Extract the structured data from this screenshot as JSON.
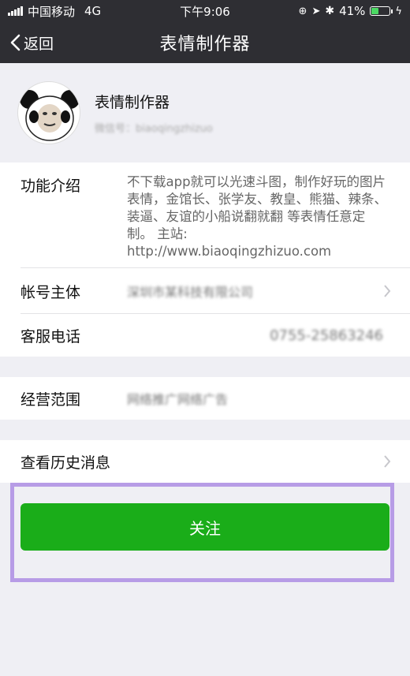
{
  "status_bar": {
    "carrier": "中国移动",
    "network": "4G",
    "time": "下午9:06",
    "battery_percent_label": "41%",
    "battery_level": 0.41
  },
  "nav": {
    "back_label": "返回",
    "title": "表情制作器"
  },
  "profile": {
    "name": "表情制作器",
    "wechat_id_blurred": "微信号：biaoqingzhizuo"
  },
  "info": {
    "intro_label": "功能介绍",
    "intro_text": "不下载app就可以光速斗图，制作好玩的图片表情，金馆长、张学友、教皇、熊猫、辣条、装逼、友谊的小船说翻就翻 等表情任意定制。 主站: http://www.biaoqingzhizuo.com",
    "account_label": "帐号主体",
    "account_value_blurred": "深圳市某科技有限公司",
    "phone_label": "客服电话",
    "phone_value_blurred": "0755-25863246",
    "scope_label": "经营范围",
    "scope_value_blurred": "网络推广网络广告",
    "history_label": "查看历史消息"
  },
  "actions": {
    "follow_label": "关注"
  },
  "colors": {
    "topbar": "#2e2e33",
    "follow_green": "#1aad19",
    "highlight_border": "#b79ce6"
  }
}
